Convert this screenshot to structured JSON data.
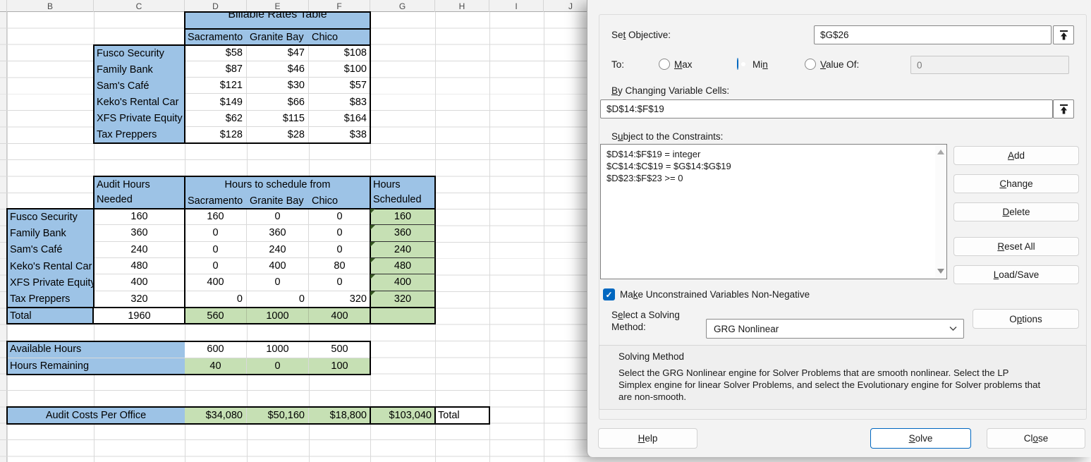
{
  "sheet": {
    "columns": [
      "B",
      "C",
      "D",
      "E",
      "F",
      "G",
      "H",
      "I",
      "J"
    ],
    "rates": {
      "title": "Billable Rates Table",
      "offices": [
        "Sacramento",
        "Granite Bay",
        "Chico"
      ],
      "rows": [
        [
          "Fusco Security",
          "$58",
          "$47",
          "$108"
        ],
        [
          "Family Bank",
          "$87",
          "$46",
          "$100"
        ],
        [
          "Sam's Café",
          "$121",
          "$30",
          "$57"
        ],
        [
          "Keko's Rental Car",
          "$149",
          "$66",
          "$83"
        ],
        [
          "XFS Private Equity",
          "$62",
          "$115",
          "$164"
        ],
        [
          "Tax Preppers",
          "$128",
          "$28",
          "$38"
        ]
      ]
    },
    "schedule": {
      "needed_header": [
        "Audit Hours",
        "Needed"
      ],
      "span_header": "Hours to schedule from",
      "offices": [
        "Sacramento",
        "Granite Bay",
        "Chico"
      ],
      "scheduled_header": [
        "Hours",
        "Scheduled"
      ],
      "rows": [
        [
          "Fusco Security",
          "160",
          "160",
          "0",
          "0",
          "160"
        ],
        [
          "Family Bank",
          "360",
          "0",
          "360",
          "0",
          "360"
        ],
        [
          "Sam's Café",
          "240",
          "0",
          "240",
          "0",
          "240"
        ],
        [
          "Keko's Rental Car",
          "480",
          "0",
          "400",
          "80",
          "480"
        ],
        [
          "XFS Private Equity",
          "400",
          "400",
          "0",
          "0",
          "400"
        ],
        [
          "Tax Preppers",
          "320",
          "0",
          "0",
          "320",
          "320"
        ]
      ],
      "total": [
        "Total",
        "1960",
        "560",
        "1000",
        "400"
      ]
    },
    "available": {
      "label": "Available Hours",
      "values": [
        "600",
        "1000",
        "500"
      ]
    },
    "remaining": {
      "label": "Hours Remaining",
      "values": [
        "40",
        "0",
        "100"
      ]
    },
    "costs": {
      "label": "Audit Costs Per Office",
      "values": [
        "$34,080",
        "$50,160",
        "$18,800"
      ],
      "total": "$103,040",
      "total_label": "Total"
    }
  },
  "solver": {
    "set_objective_label": "Set Objective:",
    "objective_value": "$G$26",
    "to_label": "To:",
    "max_label": "Max",
    "min_label": "Min",
    "value_of_label": "Value Of:",
    "value_of_value": "0",
    "by_changing_label": "By Changing Variable Cells:",
    "changing_value": "$D$14:$F$19",
    "constraints_label": "Subject to the Constraints:",
    "constraints": [
      "$D$14:$F$19 = integer",
      "$C$14:$C$19 = $G$14:$G$19",
      "$D$23:$F$23 >= 0"
    ],
    "non_negative_label": "Make Unconstrained Variables Non-Negative",
    "method_label": "Select a Solving Method:",
    "method_value": "GRG Nonlinear",
    "solving_method_title": "Solving Method",
    "solving_method_desc": "Select the GRG Nonlinear engine for Solver Problems that are smooth nonlinear. Select the LP Simplex engine for linear Solver Problems, and select the Evolutionary engine for Solver problems that are non-smooth.",
    "buttons": {
      "add": "Add",
      "change": "Change",
      "delete": "Delete",
      "reset_all": "Reset All",
      "load_save": "Load/Save",
      "options": "Options",
      "help": "Help",
      "solve": "Solve",
      "close": "Close"
    }
  },
  "colors": {
    "cell_blue": "#9dc3e6",
    "cell_green": "#c6e0b4",
    "accent_blue": "#0067c0",
    "triangle_green": "#375623"
  }
}
